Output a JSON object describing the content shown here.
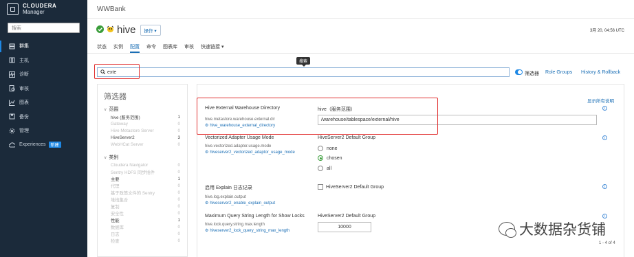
{
  "app": {
    "brand_line1": "CLOUDERA",
    "brand_line2": "Manager",
    "cluster_name": "WWBank"
  },
  "sidebar": {
    "search_placeholder": "搜索",
    "items": [
      {
        "label": "群集",
        "icon": "cluster-icon",
        "active": true
      },
      {
        "label": "主机",
        "icon": "hosts-icon"
      },
      {
        "label": "诊断",
        "icon": "diagnostics-icon"
      },
      {
        "label": "审核",
        "icon": "audit-icon"
      },
      {
        "label": "图表",
        "icon": "charts-icon"
      },
      {
        "label": "备份",
        "icon": "backup-icon"
      },
      {
        "label": "管理",
        "icon": "gear-icon"
      },
      {
        "label": "Experiences",
        "icon": "cloud-icon",
        "badge": "新建"
      }
    ]
  },
  "service": {
    "name": "hive",
    "status": "good",
    "actions_label": "操作 ▾",
    "timestamp": "3月 20, 04:56 UTC"
  },
  "tabs": [
    "状态",
    "实例",
    "配置",
    "命令",
    "图表库",
    "审核",
    "快速链接 ▾"
  ],
  "active_tab": "配置",
  "tooltip": "搜索",
  "search": {
    "value": "exte"
  },
  "filter_toggle_label": "筛选器",
  "links": {
    "role_groups": "Role Groups",
    "history": "History & Rollback"
  },
  "filters": {
    "title": "筛选器",
    "scope_label": "范围",
    "scope": [
      {
        "label": "hive (服务范围)",
        "count": "1",
        "on": true
      },
      {
        "label": "Gateway",
        "count": "0"
      },
      {
        "label": "Hive Metastore Server",
        "count": "0"
      },
      {
        "label": "HiveServer2",
        "count": "3",
        "on": true
      },
      {
        "label": "WebHCat Server",
        "count": "0"
      }
    ],
    "category_label": "类别",
    "categories": [
      {
        "label": "Cloudera Navigator",
        "count": "0"
      },
      {
        "label": "Sentry HDFS 同步插件",
        "count": "0"
      },
      {
        "label": "主要",
        "count": "1",
        "on": true
      },
      {
        "label": "代理",
        "count": "0"
      },
      {
        "label": "基于政策文件的 Sentry",
        "count": "0"
      },
      {
        "label": "堆栈集合",
        "count": "0"
      },
      {
        "label": "复制",
        "count": "0"
      },
      {
        "label": "安全性",
        "count": "0"
      },
      {
        "label": "性能",
        "count": "1",
        "on": true
      },
      {
        "label": "数据库",
        "count": "0"
      },
      {
        "label": "日志",
        "count": "0"
      },
      {
        "label": "检查",
        "count": "0"
      }
    ]
  },
  "config": {
    "show_all_desc": "显示所有说明",
    "properties": [
      {
        "title": "Hive External Warehouse Directory",
        "key": "hive.metastore.warehouse.external.dir",
        "link": "hive_warehouse_external_directory",
        "scope": "hive（服务范围）",
        "value": "/warehouse/tablespace/external/hive"
      },
      {
        "title": "Vectorized Adapter Usage Mode",
        "key": "hive.vectorized.adaptor.usage.mode",
        "link": "hiveserver2_vectorized_adaptor_usage_mode",
        "scope": "HiveServer2 Default Group",
        "options": [
          "none",
          "chosen",
          "all"
        ],
        "selected": "chosen"
      },
      {
        "title": "启用 Explain 日志记录",
        "key": "hive.log.explain.output",
        "link": "hiveserver2_enable_explain_output",
        "scope": "HiveServer2 Default Group",
        "checked": false
      },
      {
        "title": "Maximum Query String Length for Show Locks",
        "key": "hive.lock.query.string.max.length",
        "link": "hiveserver2_lock_query_string_max_length",
        "scope": "HiveServer2 Default Group",
        "value": "10000"
      }
    ],
    "pager": "1 - 4 of 4"
  },
  "watermark": "大数据杂货铺",
  "colors": {
    "sidebar_bg": "#1b2a3a",
    "link": "#1a6eb5",
    "accent": "#1e88e5",
    "highlight": "#e13030",
    "good": "#3a9d3a"
  }
}
